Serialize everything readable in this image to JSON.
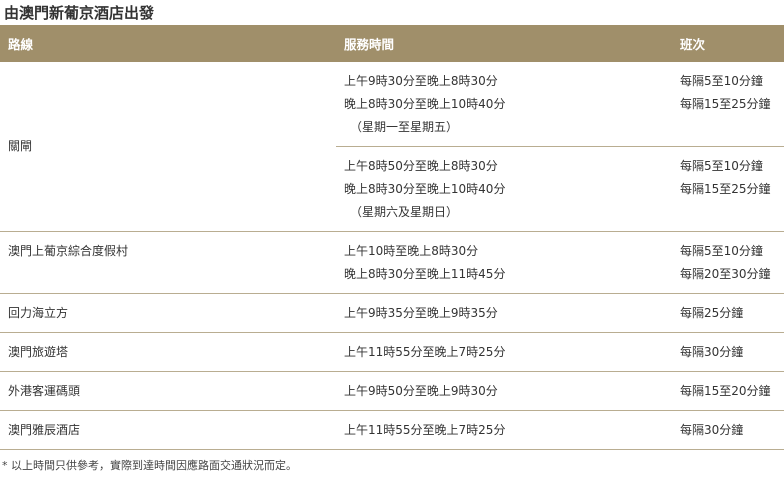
{
  "page": {
    "title": "由澳門新葡京酒店出發",
    "footnote": "* 以上時間只供參考，實際到達時間因應路面交通狀況而定。"
  },
  "table": {
    "headers": {
      "route": "路線",
      "hours": "服務時間",
      "frequency": "班次"
    },
    "rows": [
      {
        "route": "關閘",
        "sessions": [
          {
            "hours": [
              "上午9時30分至晚上8時30分",
              "晚上8時30分至晚上10時40分"
            ],
            "note": "（星期一至星期五）",
            "frequency": [
              "每隔5至10分鐘",
              "每隔15至25分鐘"
            ]
          },
          {
            "hours": [
              "上午8時50分至晚上8時30分",
              "晚上8時30分至晚上10時40分"
            ],
            "note": "（星期六及星期日）",
            "frequency": [
              "每隔5至10分鐘",
              "每隔15至25分鐘"
            ]
          }
        ]
      },
      {
        "route": "澳門上葡京綜合度假村",
        "hours": [
          "上午10時至晚上8時30分",
          "晚上8時30分至晚上11時45分"
        ],
        "frequency": [
          "每隔5至10分鐘",
          "每隔20至30分鐘"
        ]
      },
      {
        "route": "回力海立方",
        "hours": [
          "上午9時35分至晚上9時35分"
        ],
        "frequency": [
          "每隔25分鐘"
        ]
      },
      {
        "route": "澳門旅遊塔",
        "hours": [
          "上午11時55分至晚上7時25分"
        ],
        "frequency": [
          "每隔30分鐘"
        ]
      },
      {
        "route": "外港客運碼頭",
        "hours": [
          "上午9時50分至晚上9時30分"
        ],
        "frequency": [
          "每隔15至20分鐘"
        ]
      },
      {
        "route": "澳門雅辰酒店",
        "hours": [
          "上午11時55分至晚上7時25分"
        ],
        "frequency": [
          "每隔30分鐘"
        ]
      }
    ]
  },
  "colors": {
    "header_bg": "#a08f6a",
    "header_text": "#ffffff",
    "row_border": "#b9ad91",
    "body_text": "#333333"
  }
}
